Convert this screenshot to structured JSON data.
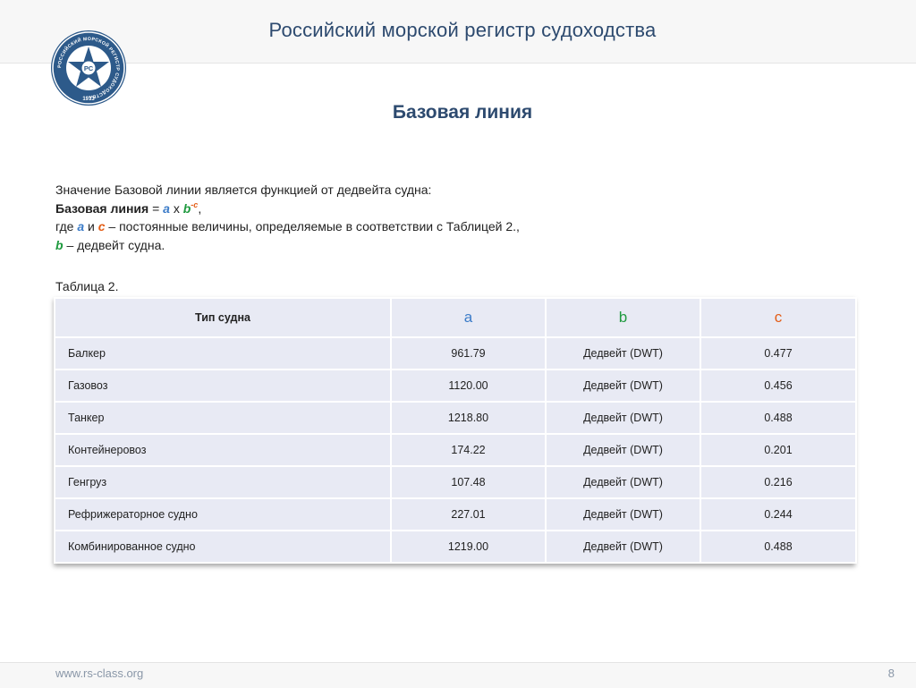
{
  "header": {
    "org_title": "Российский морской регистр судоходства",
    "logo_text": "РОССИЙСКИЙ МОРСКОЙ РЕГИСТР СУДОХОДСТВА",
    "logo_year": "1913",
    "logo_monogram": "РС"
  },
  "slide": {
    "title": "Базовая линия"
  },
  "body_text": {
    "line1": "Значение Базовой линии является функцией от дедвейта судна:",
    "line2_bold": "Базовая линия",
    "line2_eq": " = ",
    "line2_a": "a",
    "line2_x": " x ",
    "line2_b": "b",
    "line2_exp": "-c",
    "line2_end": ",",
    "line3_start": "где ",
    "line3_a": "a",
    "line3_and": " и ",
    "line3_c": "c",
    "line3_rest": " – постоянные величины, определяемые в соответствии с Таблицей 2.,",
    "line4_b": "b",
    "line4_rest": " – дедвейт судна."
  },
  "table": {
    "caption": "Таблица 2.",
    "headers": [
      "Тип судна",
      "a",
      "b",
      "c"
    ],
    "rows": [
      [
        "Балкер",
        "961.79",
        "Дедвейт (DWT)",
        "0.477"
      ],
      [
        "Газовоз",
        "1120.00",
        "Дедвейт (DWT)",
        "0.456"
      ],
      [
        "Танкер",
        "1218.80",
        "Дедвейт (DWT)",
        "0.488"
      ],
      [
        "Контейнеровоз",
        "174.22",
        "Дедвейт (DWT)",
        "0.201"
      ],
      [
        "Генгруз",
        "107.48",
        "Дедвейт (DWT)",
        "0.216"
      ],
      [
        "Рефрижераторное судно",
        "227.01",
        "Дедвейт (DWT)",
        "0.244"
      ],
      [
        "Комбинированное судно",
        "1219.00",
        "Дедвейт (DWT)",
        "0.488"
      ]
    ]
  },
  "footer": {
    "url": "www.rs-class.org",
    "page_number": "8"
  },
  "colors": {
    "title": "#2d4a6f",
    "var_a": "#3c7cc8",
    "var_b": "#1f9a3f",
    "var_c": "#e35d16",
    "table_bg": "#e8eaf4"
  }
}
